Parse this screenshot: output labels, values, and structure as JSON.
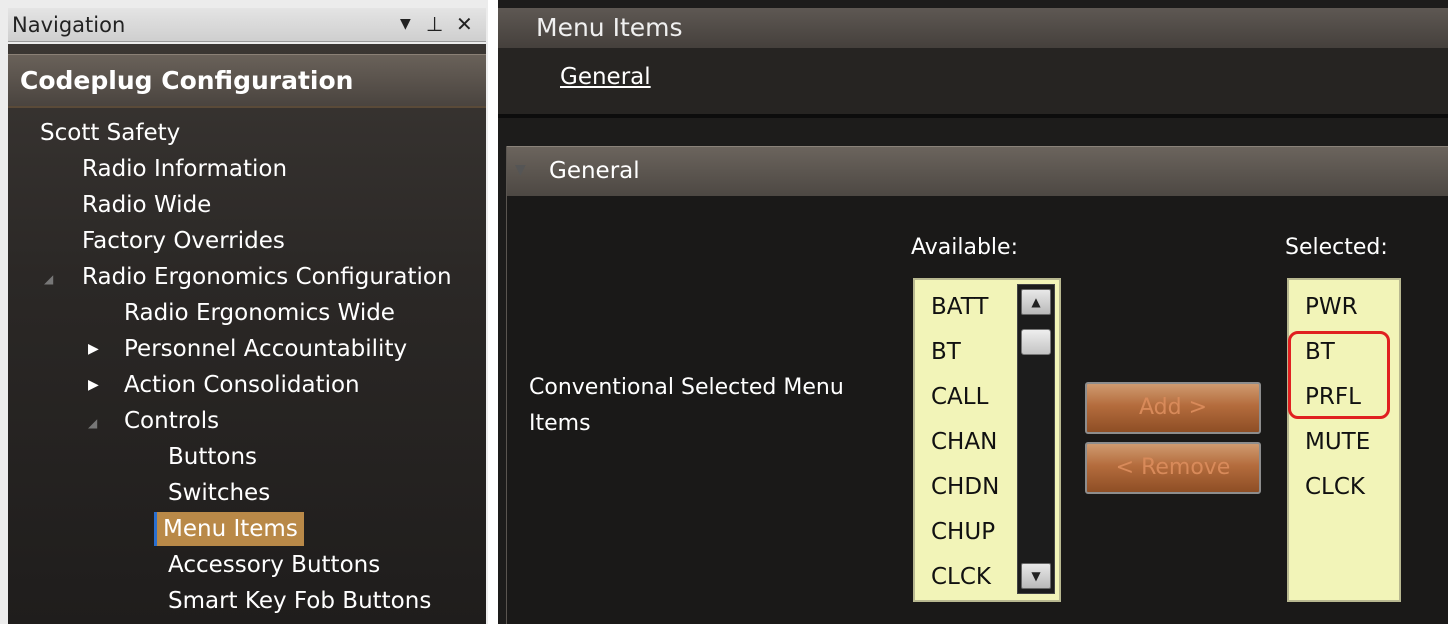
{
  "navigation": {
    "title": "Navigation",
    "dropdown_icon": "▼",
    "pin_icon": "⊥",
    "close_icon": "✕",
    "section_title": "Codeplug Configuration",
    "tree": {
      "root": "Scott Safety",
      "radio_information": "Radio Information",
      "radio_wide": "Radio Wide",
      "factory_overrides": "Factory Overrides",
      "radio_ergonomics_configuration": "Radio Ergonomics Configuration",
      "radio_ergonomics_wide": "Radio Ergonomics Wide",
      "personnel_accountability": "Personnel Accountability",
      "action_consolidation": "Action Consolidation",
      "controls": "Controls",
      "buttons": "Buttons",
      "switches": "Switches",
      "menu_items": "Menu Items",
      "accessory_buttons": "Accessory Buttons",
      "smart_key_fob_buttons": "Smart Key Fob Buttons"
    },
    "expander_collapsed": "▶",
    "expander_expanded": "◢"
  },
  "content": {
    "title": "Menu Items",
    "tab_general": "General",
    "group_title": "General",
    "group_arrow": "▼",
    "field_label": "Conventional Selected Menu Items",
    "available_label": "Available:",
    "selected_label": "Selected:",
    "available_items": [
      "BATT",
      "BT",
      "CALL",
      "CHAN",
      "CHDN",
      "CHUP",
      "CLCK"
    ],
    "selected_items": [
      "PWR",
      "BT",
      "PRFL",
      "MUTE",
      "CLCK"
    ],
    "add_button": "Add >",
    "remove_button": "< Remove",
    "scroll_up_icon": "▲",
    "scroll_down_icon": "▼",
    "colors": {
      "selection_highlight": "#b98948",
      "listbox_background": "#f2f4b8",
      "callout_border": "#e02020"
    }
  }
}
